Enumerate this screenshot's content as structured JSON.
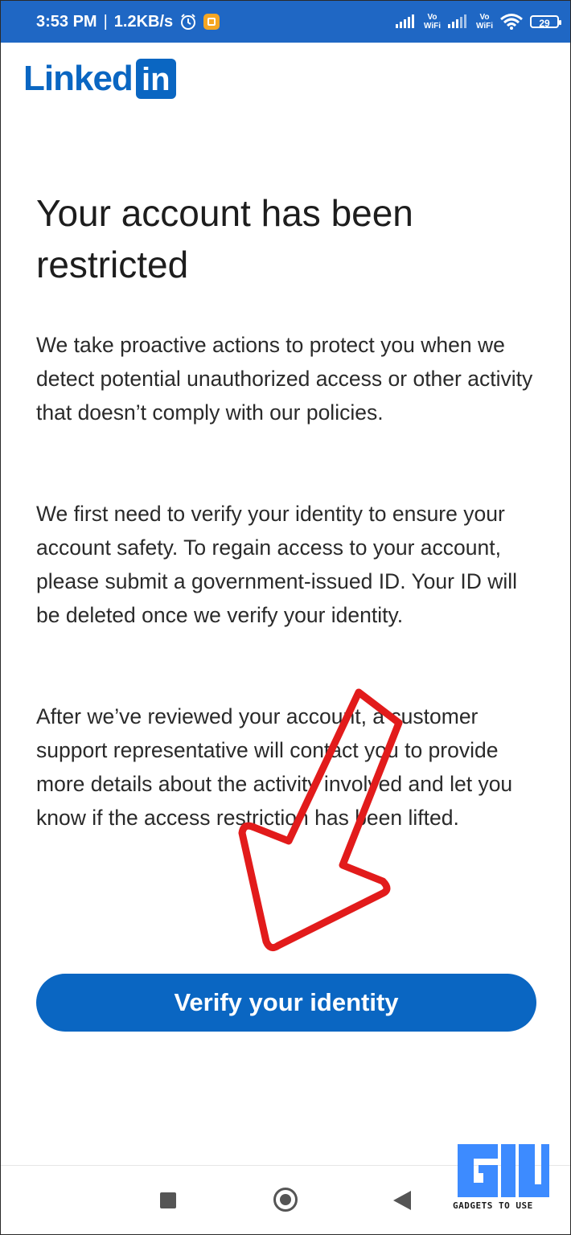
{
  "status_bar": {
    "time": "3:53 PM",
    "separator": "|",
    "network_speed": "1.2KB/s",
    "vowifi_1_top": "Vo",
    "vowifi_1_bottom": "WiFi",
    "vowifi_2_top": "Vo",
    "vowifi_2_bottom": "WiFi",
    "battery": "29",
    "icons": [
      "alarm-icon",
      "notification-app-icon",
      "signal-icon",
      "wifi-icon",
      "battery-icon"
    ]
  },
  "brand": {
    "name": "Linked",
    "box": "in",
    "color": "#0a66c2"
  },
  "content": {
    "title": "Your account has been restricted",
    "paragraph_1": "We take proactive actions to protect you when we detect potential unauthorized access or other activity that doesn’t comply with our policies.",
    "paragraph_2": "We first need to verify your identity to ensure your account safety. To regain access to your account, please submit a government-issued ID. Your ID will be deleted once we verify your identity.",
    "paragraph_3": "After we’ve reviewed your account, a customer support representative will contact you to provide more details about the activity involved and let you know if the access restriction has been lifted."
  },
  "actions": {
    "verify_label": "Verify your identity"
  },
  "annotation": {
    "arrow_color": "#e21b1b"
  },
  "navigation": {
    "icons": [
      "recents-square-icon",
      "home-circle-icon",
      "back-triangle-icon"
    ]
  },
  "watermark": {
    "text": "GADGETS TO USE",
    "color": "#3d8bff"
  }
}
